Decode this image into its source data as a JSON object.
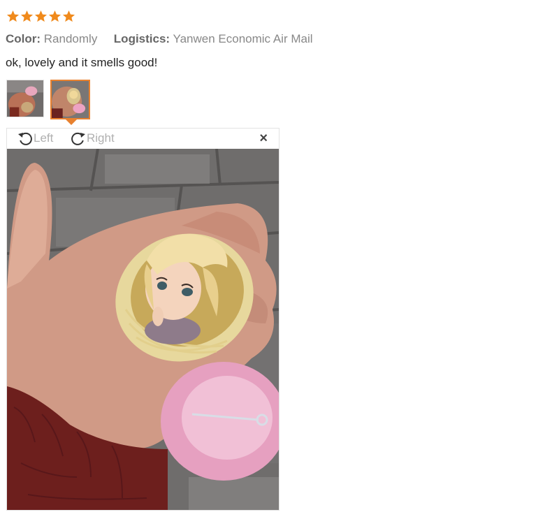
{
  "review": {
    "rating": 5,
    "star_color": "#f08a1c",
    "color_label": "Color:",
    "color_value": "Randomly",
    "logistics_label": "Logistics:",
    "logistics_value": "Yanwen Economic Air Mail",
    "text": "ok, lovely and it smells good!"
  },
  "thumbnails": [
    {
      "name": "photo-thumbnail-1",
      "selected": false
    },
    {
      "name": "photo-thumbnail-2",
      "selected": true
    }
  ],
  "viewer": {
    "rotate_left_label": "Left",
    "rotate_right_label": "Right",
    "close_glyph": "×",
    "accent": "#e8812f"
  }
}
